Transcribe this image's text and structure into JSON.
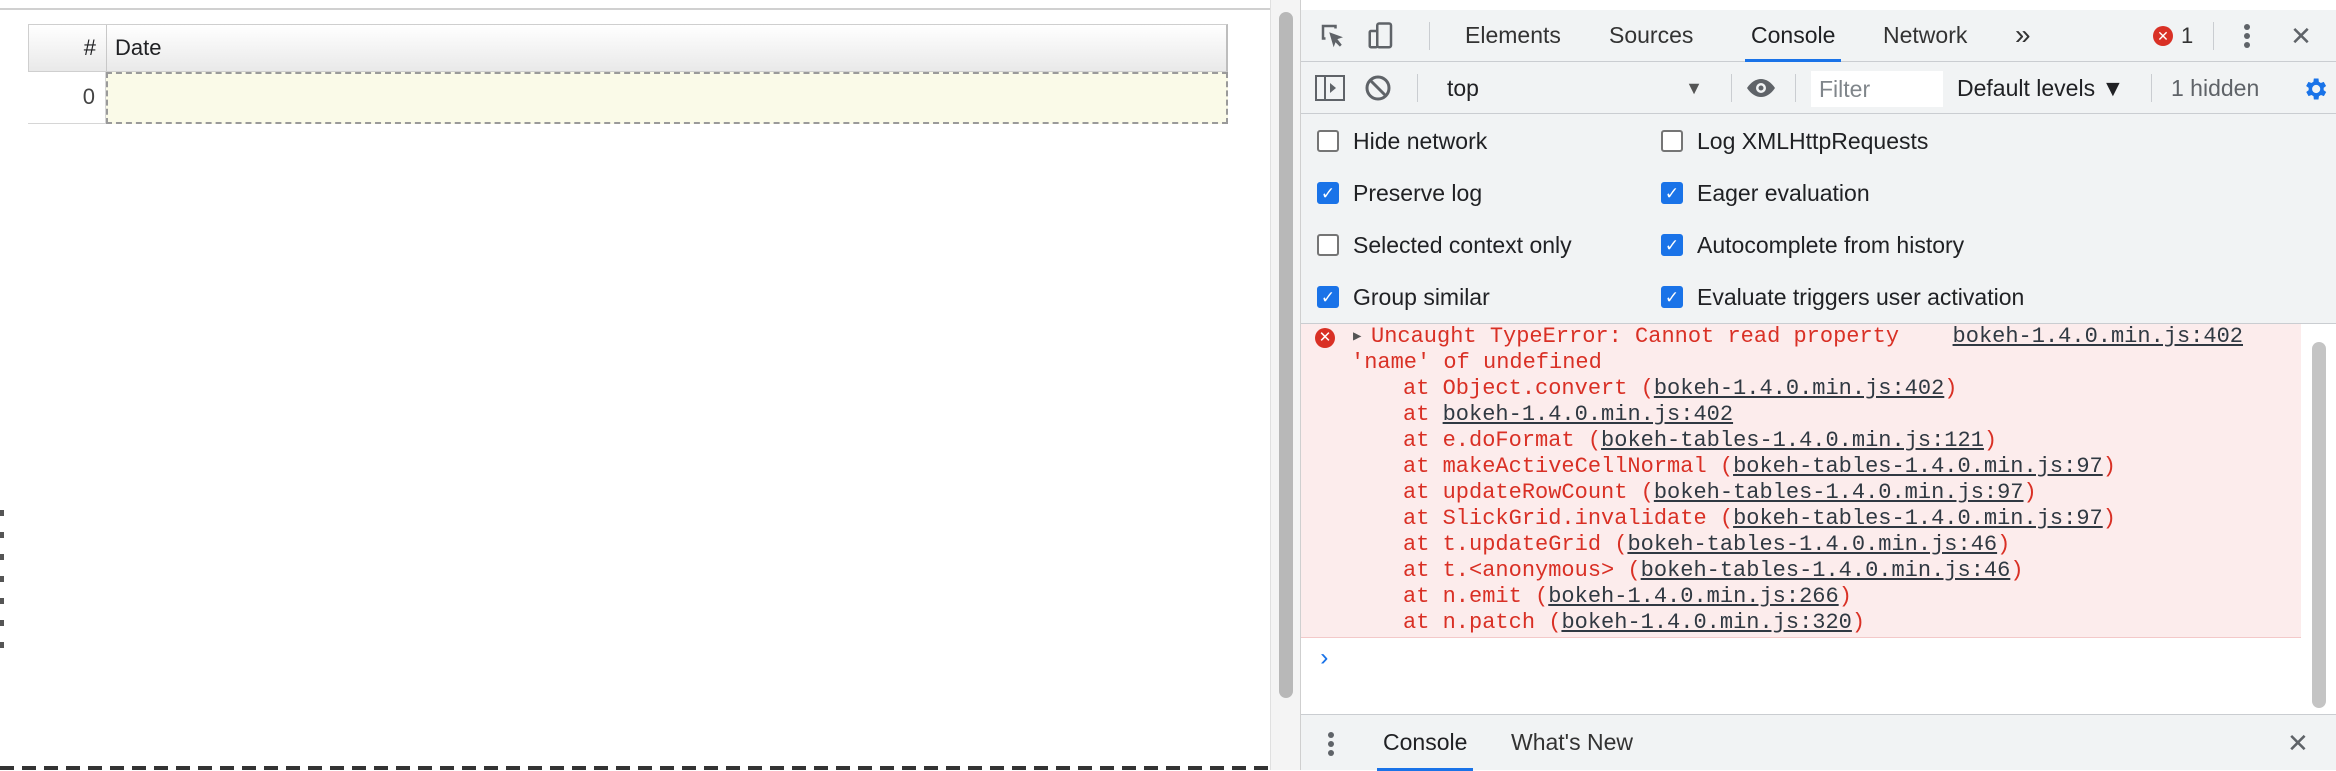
{
  "table": {
    "headers": [
      "#",
      "Date"
    ],
    "rows": [
      {
        "index": "0",
        "date": ""
      }
    ]
  },
  "devtools": {
    "tabs": [
      "Elements",
      "Sources",
      "Console",
      "Network"
    ],
    "active_tab": "Console",
    "more_tabs_glyph": "»",
    "error_count": "1",
    "close_glyph": "✕",
    "toolbar": {
      "context": "top",
      "filter_placeholder": "Filter",
      "levels": "Default levels ▼",
      "hidden": "1 hidden"
    },
    "settings": {
      "hide_network": {
        "label": "Hide network",
        "checked": false
      },
      "log_xhr": {
        "label": "Log XMLHttpRequests",
        "checked": false
      },
      "preserve_log": {
        "label": "Preserve log",
        "checked": true
      },
      "eager_eval": {
        "label": "Eager evaluation",
        "checked": true
      },
      "selected_context": {
        "label": "Selected context only",
        "checked": false
      },
      "autocomplete": {
        "label": "Autocomplete from history",
        "checked": true
      },
      "group_similar": {
        "label": "Group similar",
        "checked": true
      },
      "eval_triggers": {
        "label": "Evaluate triggers user activation",
        "checked": true
      }
    },
    "console": {
      "error_line1": "Uncaught TypeError: Cannot read property",
      "error_line2": "'name' of undefined",
      "error_source": "bokeh-1.4.0.min.js:402",
      "stack": [
        {
          "pre": "at Object.convert (",
          "link": "bokeh-1.4.0.min.js:402",
          "post": ")"
        },
        {
          "pre": "at ",
          "link": "bokeh-1.4.0.min.js:402",
          "post": ""
        },
        {
          "pre": "at e.doFormat (",
          "link": "bokeh-tables-1.4.0.min.js:121",
          "post": ")"
        },
        {
          "pre": "at makeActiveCellNormal (",
          "link": "bokeh-tables-1.4.0.min.js:97",
          "post": ")"
        },
        {
          "pre": "at updateRowCount (",
          "link": "bokeh-tables-1.4.0.min.js:97",
          "post": ")"
        },
        {
          "pre": "at SlickGrid.invalidate (",
          "link": "bokeh-tables-1.4.0.min.js:97",
          "post": ")"
        },
        {
          "pre": "at t.updateGrid (",
          "link": "bokeh-tables-1.4.0.min.js:46",
          "post": ")"
        },
        {
          "pre": "at t.<anonymous> (",
          "link": "bokeh-tables-1.4.0.min.js:46",
          "post": ")"
        },
        {
          "pre": "at n.emit (",
          "link": "bokeh-1.4.0.min.js:266",
          "post": ")"
        },
        {
          "pre": "at n.patch (",
          "link": "bokeh-1.4.0.min.js:320",
          "post": ")"
        }
      ],
      "prompt_glyph": "›"
    },
    "drawer": {
      "tabs": [
        "Console",
        "What's New"
      ],
      "active": "Console",
      "close_glyph": "✕"
    }
  },
  "colors": {
    "accent": "#1a73e8",
    "error": "#d93025",
    "error_bg": "#fcecec",
    "selected_cell_bg": "#fafae8"
  },
  "icons": [
    "inspect-element-icon",
    "device-toolbar-icon",
    "error-icon",
    "kebab-menu-icon",
    "close-icon",
    "sidebar-toggle-icon",
    "clear-console-icon",
    "eye-icon",
    "gear-icon",
    "chevron-right-icon"
  ]
}
